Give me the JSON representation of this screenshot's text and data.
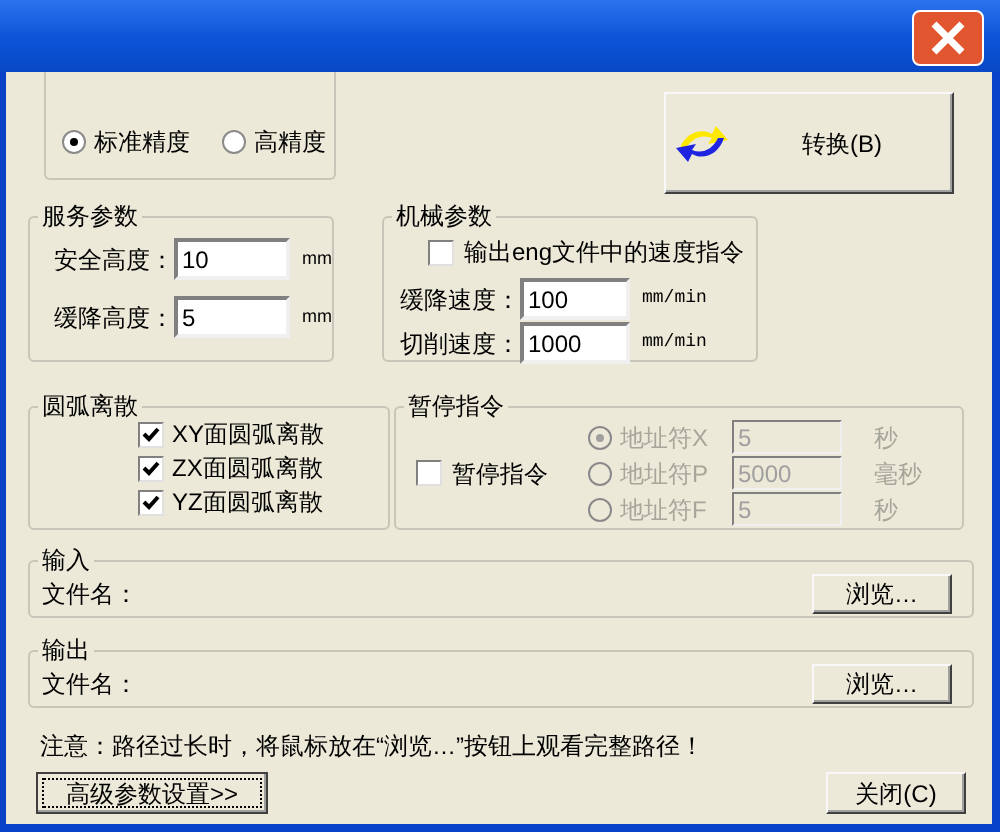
{
  "precision": {
    "options": [
      {
        "label": "标准精度",
        "selected": true
      },
      {
        "label": "高精度",
        "selected": false
      }
    ]
  },
  "convert_button": {
    "label": "转换(B)"
  },
  "service_params": {
    "title": "服务参数",
    "fields": [
      {
        "label": "安全高度：",
        "value": "10",
        "unit": "mm"
      },
      {
        "label": "缓降高度：",
        "value": "5",
        "unit": "mm"
      }
    ]
  },
  "machine_params": {
    "title": "机械参数",
    "speed_checkbox": {
      "label": "输出eng文件中的速度指令",
      "checked": false
    },
    "fields": [
      {
        "label": "缓降速度：",
        "value": "100",
        "unit": "mm/min"
      },
      {
        "label": "切削速度：",
        "value": "1000",
        "unit": "mm/min"
      }
    ]
  },
  "arc_discrete": {
    "title": "圆弧离散",
    "options": [
      {
        "label": "XY面圆弧离散",
        "checked": true
      },
      {
        "label": "ZX面圆弧离散",
        "checked": true
      },
      {
        "label": "YZ面圆弧离散",
        "checked": true
      }
    ]
  },
  "pause": {
    "title": "暂停指令",
    "checkbox": {
      "label": "暂停指令",
      "checked": false
    },
    "options": [
      {
        "label": "地址符X",
        "selected": true,
        "disabled": true,
        "value": "5",
        "unit": "秒"
      },
      {
        "label": "地址符P",
        "selected": false,
        "disabled": true,
        "value": "5000",
        "unit": "毫秒"
      },
      {
        "label": "地址符F",
        "selected": false,
        "disabled": true,
        "value": "5",
        "unit": "秒"
      }
    ]
  },
  "input": {
    "title": "输入",
    "label": "文件名：",
    "button": "浏览…"
  },
  "output": {
    "title": "输出",
    "label": "文件名：",
    "button": "浏览…"
  },
  "note": "注意：路径过长时，将鼠标放在“浏览…”按钮上观看完整路径！",
  "advanced_button": "高级参数设置>>",
  "close_button": "关闭(C)"
}
